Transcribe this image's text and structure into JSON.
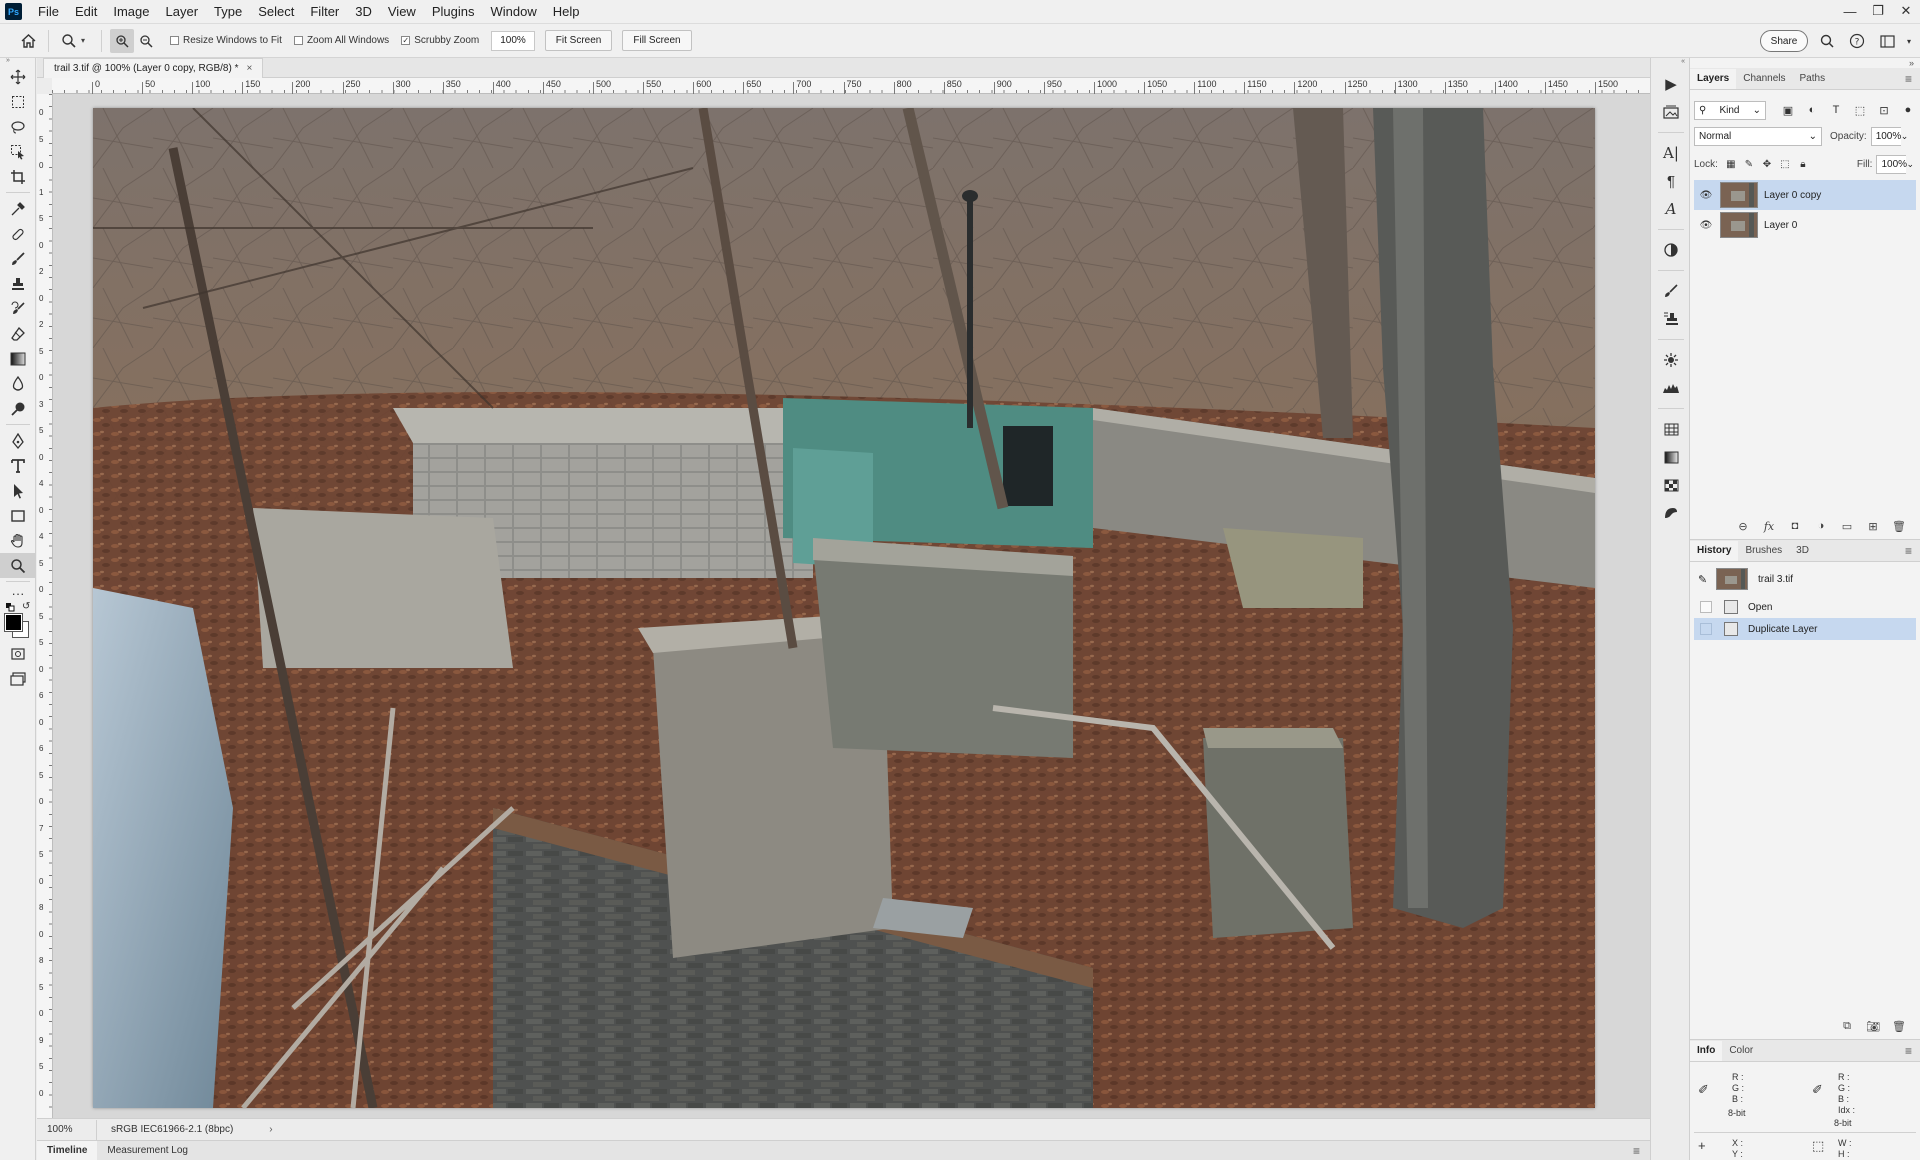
{
  "menubar": {
    "logo": "Ps",
    "items": [
      "File",
      "Edit",
      "Image",
      "Layer",
      "Type",
      "Select",
      "Filter",
      "3D",
      "View",
      "Plugins",
      "Window",
      "Help"
    ],
    "window_controls": [
      "—",
      "❐",
      "✕"
    ]
  },
  "options": {
    "resize_windows": "Resize Windows to Fit",
    "zoom_all_windows": "Zoom All Windows",
    "scrubby_zoom": "Scrubby Zoom",
    "scrubby_checked": true,
    "zoom_value": "100%",
    "fit_screen": "Fit Screen",
    "fill_screen": "Fill Screen",
    "share": "Share"
  },
  "document": {
    "tab_title": "trail 3.tif @ 100% (Layer 0 copy, RGB/8) *",
    "close": "×",
    "ruler_top_labels": [
      "0",
      "50",
      "100",
      "150",
      "200",
      "250",
      "300",
      "350",
      "400",
      "450",
      "500",
      "550",
      "600",
      "650",
      "700",
      "750",
      "800",
      "850",
      "900",
      "950",
      "1000",
      "1050",
      "1100",
      "1150",
      "1200",
      "1250",
      "1300",
      "1350",
      "1400",
      "1450",
      "1500"
    ],
    "ruler_left_labels": [
      "0",
      "5",
      "0",
      "1",
      "5",
      "0",
      "2",
      "0",
      "2",
      "5",
      "0",
      "3",
      "5",
      "0",
      "4",
      "0",
      "4",
      "5",
      "0",
      "5",
      "5",
      "0",
      "6",
      "0",
      "6",
      "5",
      "0",
      "7",
      "5",
      "0",
      "8",
      "0",
      "8",
      "5",
      "0",
      "9",
      "5",
      "0"
    ]
  },
  "status": {
    "zoom": "100%",
    "profile": "sRGB IEC61966-2.1 (8bpc)",
    "arrow": "›"
  },
  "bottom_tabs": [
    "Timeline",
    "Measurement Log"
  ],
  "layers_panel": {
    "tabs": [
      "Layers",
      "Channels",
      "Paths"
    ],
    "filter_kind": "Kind",
    "blend_mode": "Normal",
    "opacity_label": "Opacity:",
    "opacity_value": "100%",
    "lock_label": "Lock:",
    "fill_label": "Fill:",
    "fill_value": "100%",
    "layers": [
      {
        "name": "Layer 0 copy",
        "selected": true
      },
      {
        "name": "Layer 0",
        "selected": false
      }
    ]
  },
  "history_panel": {
    "tabs": [
      "History",
      "Brushes",
      "3D"
    ],
    "snapshot": "trail 3.tif",
    "items": [
      {
        "name": "Open",
        "selected": false
      },
      {
        "name": "Duplicate Layer",
        "selected": true
      }
    ]
  },
  "info_panel": {
    "tabs": [
      "Info",
      "Color"
    ],
    "rgb_left": "R :\nG :\nB :",
    "rgb_right": "R :\nG :\nB :\nIdx :",
    "bit_left": "8-bit",
    "bit_right": "8-bit",
    "xy": "X :\nY :",
    "wh": "W :\nH :"
  }
}
